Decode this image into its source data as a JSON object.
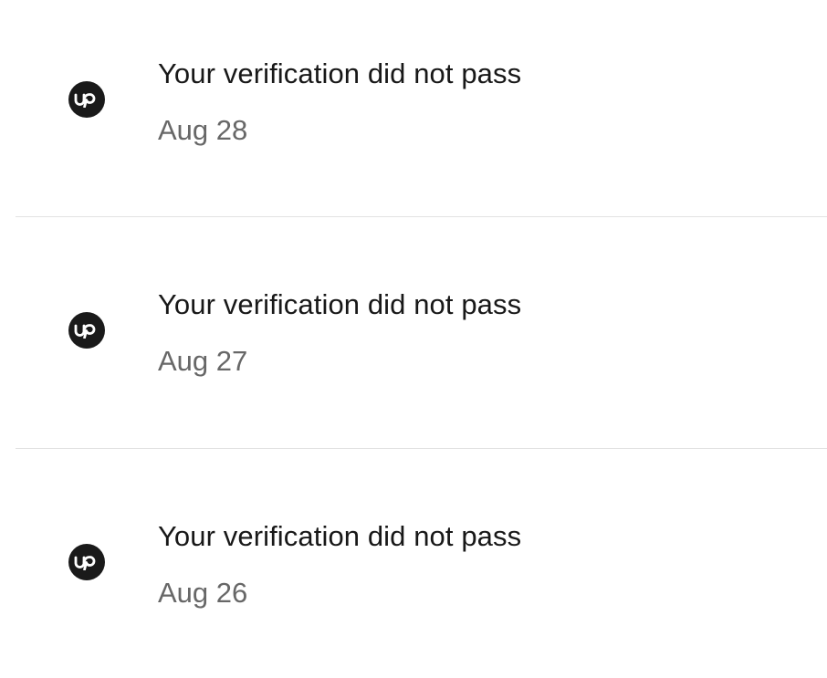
{
  "notifications": [
    {
      "icon": "upwork-logo-icon",
      "title": "Your verification did not pass",
      "date": "Aug 28"
    },
    {
      "icon": "upwork-logo-icon",
      "title": "Your verification did not pass",
      "date": "Aug 27"
    },
    {
      "icon": "upwork-logo-icon",
      "title": "Your verification did not pass",
      "date": "Aug 26"
    }
  ],
  "colors": {
    "avatar_background": "#1a1a1a",
    "title_text": "#181818",
    "date_text": "#676767",
    "divider": "#e2e2e2"
  }
}
